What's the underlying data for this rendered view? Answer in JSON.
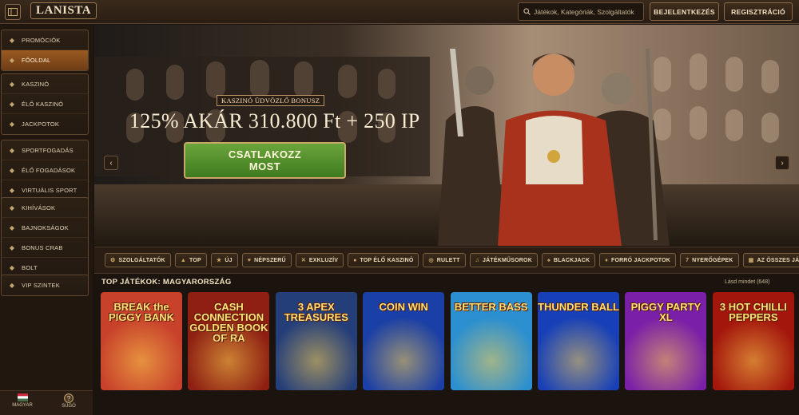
{
  "header": {
    "logo": "LANISTA",
    "search_placeholder": "Játékok, Kategóriák, Szolgáltatók",
    "login_label": "BEJELENTKEZÉS",
    "register_label": "REGISZTRÁCIÓ"
  },
  "sidebar": {
    "groups": [
      [
        {
          "label": "PROMÓCIÓK",
          "icon": "gift-icon"
        },
        {
          "label": "FŐOLDAL",
          "icon": "home-icon",
          "active": true
        }
      ],
      [
        {
          "label": "KASZINÓ",
          "icon": "cards-icon"
        },
        {
          "label": "ÉLŐ KASZINÓ",
          "icon": "live-icon"
        },
        {
          "label": "JACKPOTOK",
          "icon": "coins-icon"
        }
      ],
      [
        {
          "label": "SPORTFOGADÁS",
          "icon": "ball-icon"
        },
        {
          "label": "ÉLŐ FOGADÁSOK",
          "icon": "live-bets-icon"
        },
        {
          "label": "VIRTUÁLIS SPORT",
          "icon": "virtual-icon"
        }
      ],
      [
        {
          "label": "KIHÍVÁSOK",
          "icon": "target-icon"
        },
        {
          "label": "BAJNOKSÁGOK",
          "icon": "trophy-icon"
        },
        {
          "label": "BONUS CRAB",
          "icon": "crab-icon"
        },
        {
          "label": "BOLT",
          "icon": "shop-icon"
        }
      ],
      [
        {
          "label": "VIP SZINTEK",
          "icon": "crown-icon"
        }
      ]
    ],
    "language_label": "MAGYAR",
    "help_label": "SÚGÓ"
  },
  "hero": {
    "bonus_tag": "KASZINÓ ÜDVÖZLŐ BONUSZ",
    "headline": "125% AKÁR 310.800 Ft + 250 IP",
    "cta_line1": "CSATLAKOZZ",
    "cta_line2": "MOST",
    "prev": "‹",
    "next": "›"
  },
  "categories": [
    {
      "label": "SZOLGÁLTATÓK",
      "icon": "⚙"
    },
    {
      "label": "TOP",
      "icon": "▲"
    },
    {
      "label": "ÚJ",
      "icon": "★"
    },
    {
      "label": "NÉPSZERŰ",
      "icon": "♥"
    },
    {
      "label": "EXKLUZÍV",
      "icon": "✕"
    },
    {
      "label": "TOP ÉLŐ KASZINÓ",
      "icon": "●"
    },
    {
      "label": "RULETT",
      "icon": "◎"
    },
    {
      "label": "JÁTÉKMŰSOROK",
      "icon": "♫"
    },
    {
      "label": "BLACKJACK",
      "icon": "♠"
    },
    {
      "label": "FORRÓ JACKPOTOK",
      "icon": "♦"
    },
    {
      "label": "NYERŐGÉPEK",
      "icon": "7"
    },
    {
      "label": "AZ ÖSSZES JÁTÉK",
      "icon": "▦"
    }
  ],
  "top_games": {
    "title": "TOP JÁTÉKOK: MAGYARORSZÁG",
    "see_all": "Lásd mindet (648)",
    "games": [
      {
        "title": "BREAK the PIGGY BANK",
        "bg": "#c8412b"
      },
      {
        "title": "CASH CONNECTION GOLDEN BOOK OF RA",
        "bg": "#8e1f12"
      },
      {
        "title": "3 APEX TREASURES",
        "bg": "#243e7a"
      },
      {
        "title": "COIN WIN",
        "bg": "#1a3fa6"
      },
      {
        "title": "BETTER BASS",
        "bg": "#2b8fd0"
      },
      {
        "title": "THUNDER BALL",
        "bg": "#1740b8"
      },
      {
        "title": "PIGGY PARTY XL",
        "bg": "#7a1fa8"
      },
      {
        "title": "3 HOT CHILLI PEPPERS",
        "bg": "#a3160c"
      }
    ]
  }
}
